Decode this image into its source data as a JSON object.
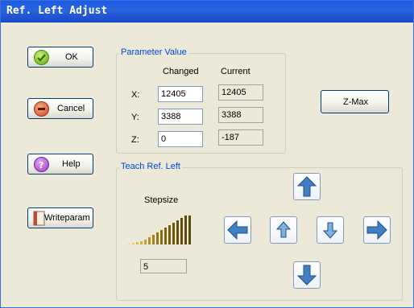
{
  "window": {
    "title": "Ref. Left Adjust"
  },
  "buttons": {
    "ok": "OK",
    "cancel": "Cancel",
    "help": "Help",
    "writeparam": "Writeparam",
    "zmax": "Z-Max"
  },
  "parameter": {
    "legend": "Parameter Value",
    "col_changed": "Changed",
    "col_current": "Current",
    "rows": [
      {
        "axis": "X:",
        "changed": "12405",
        "current": "12405"
      },
      {
        "axis": "Y:",
        "changed": "3388",
        "current": "3388"
      },
      {
        "axis": "Z:",
        "changed": "0",
        "current": "-187"
      }
    ]
  },
  "teach": {
    "legend": "Teach Ref. Left",
    "stepsize_label": "Stepsize",
    "stepsize_value": "5"
  },
  "colors": {
    "title_bar": "#2458dc",
    "accent": "#0046d5",
    "stepsize_bars": "#7a7a10",
    "arrow_blue": "#3f7fc4"
  },
  "icons": [
    "check-icon",
    "minus-icon",
    "question-icon",
    "book-icon",
    "arrow-up-icon",
    "arrow-down-icon",
    "arrow-left-icon",
    "arrow-right-icon",
    "z-up-icon",
    "z-down-icon"
  ]
}
